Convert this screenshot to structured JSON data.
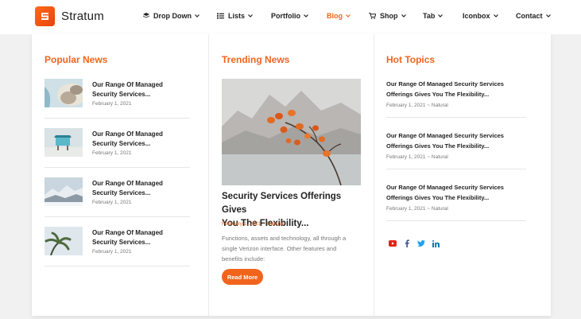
{
  "brand": {
    "name": "Stratum"
  },
  "nav": [
    {
      "label": "Drop Down",
      "icon": "layers-icon"
    },
    {
      "label": "Lists",
      "icon": "list-icon"
    },
    {
      "label": "Portfolio"
    },
    {
      "label": "Blog",
      "active": true
    },
    {
      "label": "Shop",
      "icon": "cart-icon"
    },
    {
      "label": "Tab"
    },
    {
      "label": "Iconbox"
    },
    {
      "label": "Contact"
    }
  ],
  "popular": {
    "title": "Popular News",
    "items": [
      {
        "title_l1": "Our Range Of Managed",
        "title_l2": "Security Services...",
        "date": "February 1, 2021"
      },
      {
        "title_l1": "Our Range Of Managed",
        "title_l2": "Security Services...",
        "date": "February 1, 2021"
      },
      {
        "title_l1": "Our Range Of Managed",
        "title_l2": "Security Services...",
        "date": "February 1, 2021"
      },
      {
        "title_l1": "Our Range Of Managed",
        "title_l2": "Security Services...",
        "date": "February 1, 2021"
      }
    ]
  },
  "trending": {
    "title": "Trending News",
    "headline_l1": "Security Services Offerings Gives",
    "headline_l2": "You The Flexibility...",
    "meta": "February 1, 2021 ~ Natural",
    "body_l1": "Functions, assets and technology, all through a",
    "body_l2": "single Verizon interface. Other features and",
    "body_l3": "benefits include:",
    "button": "Read More"
  },
  "hot": {
    "title": "Hot Topics",
    "items": [
      {
        "title_l1": "Our Range Of Managed Security Services",
        "title_l2": "Offerings Gives You The Flexibility...",
        "meta": "February 1, 2021 ~ Natural"
      },
      {
        "title_l1": "Our Range Of Managed Security Services",
        "title_l2": "Offerings Gives You The Flexibility...",
        "meta": "February 1, 2021 ~ Natural"
      },
      {
        "title_l1": "Our Range Of Managed Security Services",
        "title_l2": "Offerings Gives You The Flexibility...",
        "meta": "February 1, 2021 ~ Natural"
      }
    ]
  },
  "social": [
    "youtube-icon",
    "facebook-icon",
    "twitter-icon",
    "linkedin-icon"
  ],
  "colors": {
    "accent": "#f2641c",
    "youtube": "#e62117",
    "facebook": "#3b5998",
    "twitter": "#1da1f2",
    "linkedin": "#0077b5"
  }
}
